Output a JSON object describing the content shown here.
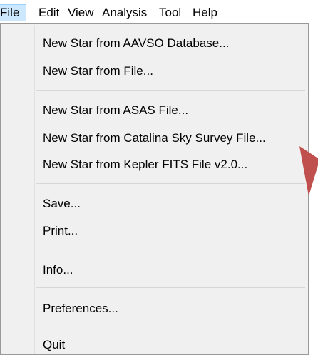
{
  "menubar": {
    "items": [
      {
        "label": "File"
      },
      {
        "label": "Edit"
      },
      {
        "label": "View"
      },
      {
        "label": "Analysis"
      },
      {
        "label": "Tool"
      },
      {
        "label": "Help"
      }
    ]
  },
  "file_menu": {
    "items": [
      {
        "label": "New Star from AAVSO Database..."
      },
      {
        "label": "New Star from File..."
      },
      {
        "label": "New Star from ASAS File..."
      },
      {
        "label": "New Star from Catalina Sky Survey File..."
      },
      {
        "label": "New Star from Kepler FITS File v2.0..."
      },
      {
        "label": "Save..."
      },
      {
        "label": "Print..."
      },
      {
        "label": "Info..."
      },
      {
        "label": "Preferences..."
      },
      {
        "label": "Quit"
      }
    ]
  },
  "colors": {
    "menu_background": "#f0f0f0",
    "active_menu_highlight": "#cce8ff",
    "annotation_arrow": "#c0504d"
  }
}
